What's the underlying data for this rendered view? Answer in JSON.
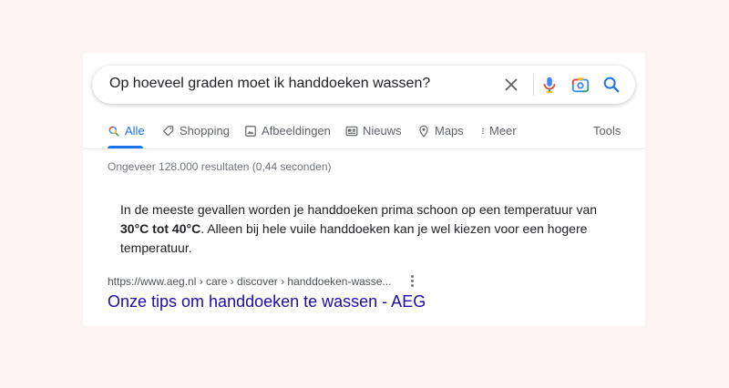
{
  "search": {
    "query": "Op hoeveel graden moet ik handdoeken wassen?",
    "icons": [
      "clear-icon",
      "microphone-icon",
      "camera-icon",
      "search-icon"
    ]
  },
  "tabs": {
    "items": [
      {
        "label": "Alle",
        "icon": "search-icon",
        "active": true
      },
      {
        "label": "Shopping",
        "icon": "tag-icon"
      },
      {
        "label": "Afbeeldingen",
        "icon": "image-icon"
      },
      {
        "label": "Nieuws",
        "icon": "news-icon"
      },
      {
        "label": "Maps",
        "icon": "map-pin-icon"
      },
      {
        "label": "Meer",
        "icon": "more-vertical-icon"
      }
    ],
    "tools_label": "Tools"
  },
  "stats": "Ongeveer 128.000 resultaten (0,44 seconden)",
  "snippet": {
    "text_before": "In de meeste gevallen worden je handdoeken prima schoon op een temperatuur van",
    "highlight": "30°C tot 40°C",
    "text_after": ". Alleen bij hele vuile handdoeken kan je wel kiezen voor een hogere temperatuur."
  },
  "result": {
    "url": "https://www.aeg.nl › care › discover › handdoeken-wasse...",
    "title": "Onze tips om handdoeken te wassen - AEG"
  },
  "colors": {
    "background": "#fcf5f3",
    "accent": "#1a73e8",
    "link": "#1a0dab"
  }
}
